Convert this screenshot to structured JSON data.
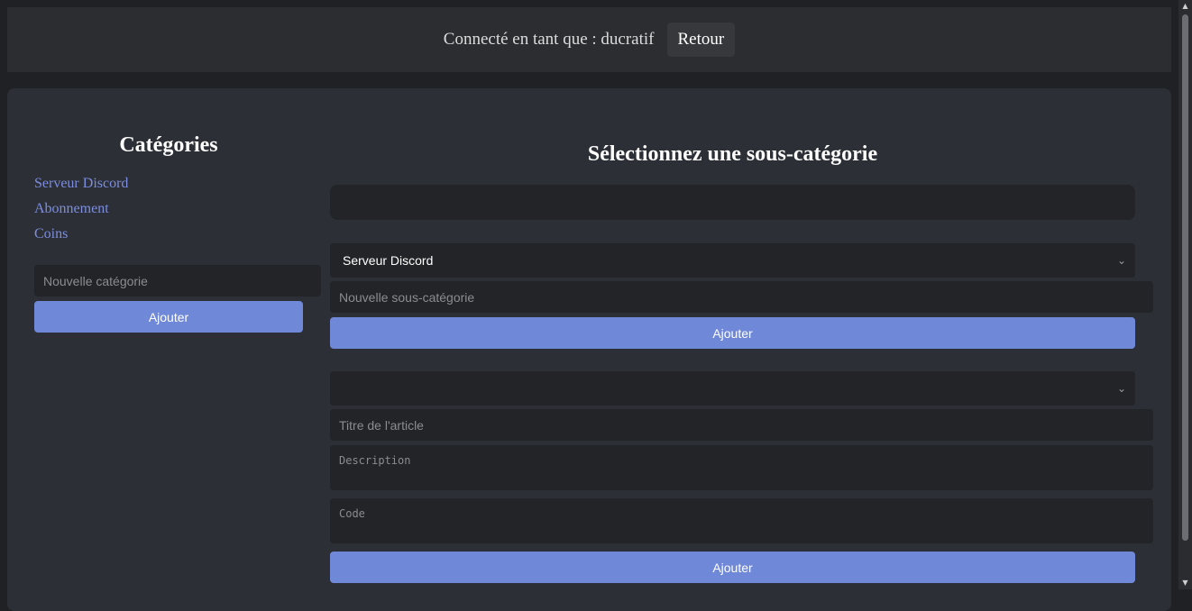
{
  "header": {
    "user_label": "Connecté en tant que : ducratif",
    "back_button": "Retour"
  },
  "sidebar": {
    "title": "Catégories",
    "categories": [
      "Serveur Discord",
      "Abonnement",
      "Coins"
    ],
    "new_category_placeholder": "Nouvelle catégorie",
    "add_button": "Ajouter"
  },
  "main": {
    "title": "Sélectionnez une sous-catégorie",
    "category_select_value": "Serveur Discord",
    "new_subcategory_placeholder": "Nouvelle sous-catégorie",
    "add_subcategory_button": "Ajouter",
    "subcategory_select_value": "",
    "article_title_placeholder": "Titre de l'article",
    "description_placeholder": "Description",
    "code_placeholder": "Code",
    "add_article_button": "Ajouter"
  },
  "colors": {
    "accent": "#7088d8",
    "link": "#7d8ee0",
    "panel": "#2c2f35",
    "background": "#1f2124"
  }
}
